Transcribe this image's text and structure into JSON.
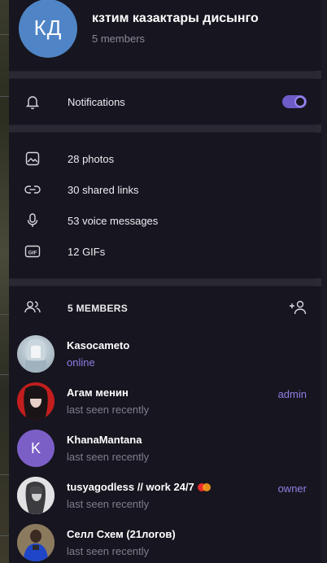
{
  "header": {
    "avatar_initials": "КД",
    "avatar_color": "#4f85c6",
    "title": "кзтим казактары дисынго",
    "subtitle": "5 members"
  },
  "notifications": {
    "label": "Notifications",
    "icon": "bell-icon",
    "enabled": true,
    "accent": "#6e5bc8"
  },
  "media": [
    {
      "icon": "photo-icon",
      "label": "28 photos"
    },
    {
      "icon": "link-icon",
      "label": "30 shared links"
    },
    {
      "icon": "microphone-icon",
      "label": "53 voice messages"
    },
    {
      "icon": "gif-icon",
      "label": "12 GIFs"
    }
  ],
  "members_section": {
    "label": "5 MEMBERS",
    "icon": "members-icon",
    "add_icon": "add-member-icon"
  },
  "members": [
    {
      "name": "Kasocameto",
      "status": "online",
      "role": "",
      "avatar_icon": "anime-avatar"
    },
    {
      "name": "Агам менин",
      "status": "last seen recently",
      "role": "admin",
      "avatar_icon": "dark-hair-avatar"
    },
    {
      "name": "KhanaMantana",
      "status": "last seen recently",
      "role": "",
      "avatar_letter": "K",
      "avatar_color": "#7b5fc7"
    },
    {
      "name": "tusyagodless // work 24/7",
      "status": "last seen recently",
      "role": "owner",
      "avatar_icon": "grey-avatar",
      "badge_icon": "card-icon"
    },
    {
      "name": "Селл Схем (21логов)",
      "status": "last seen recently",
      "role": "",
      "avatar_icon": "blue-jacket-avatar"
    }
  ]
}
